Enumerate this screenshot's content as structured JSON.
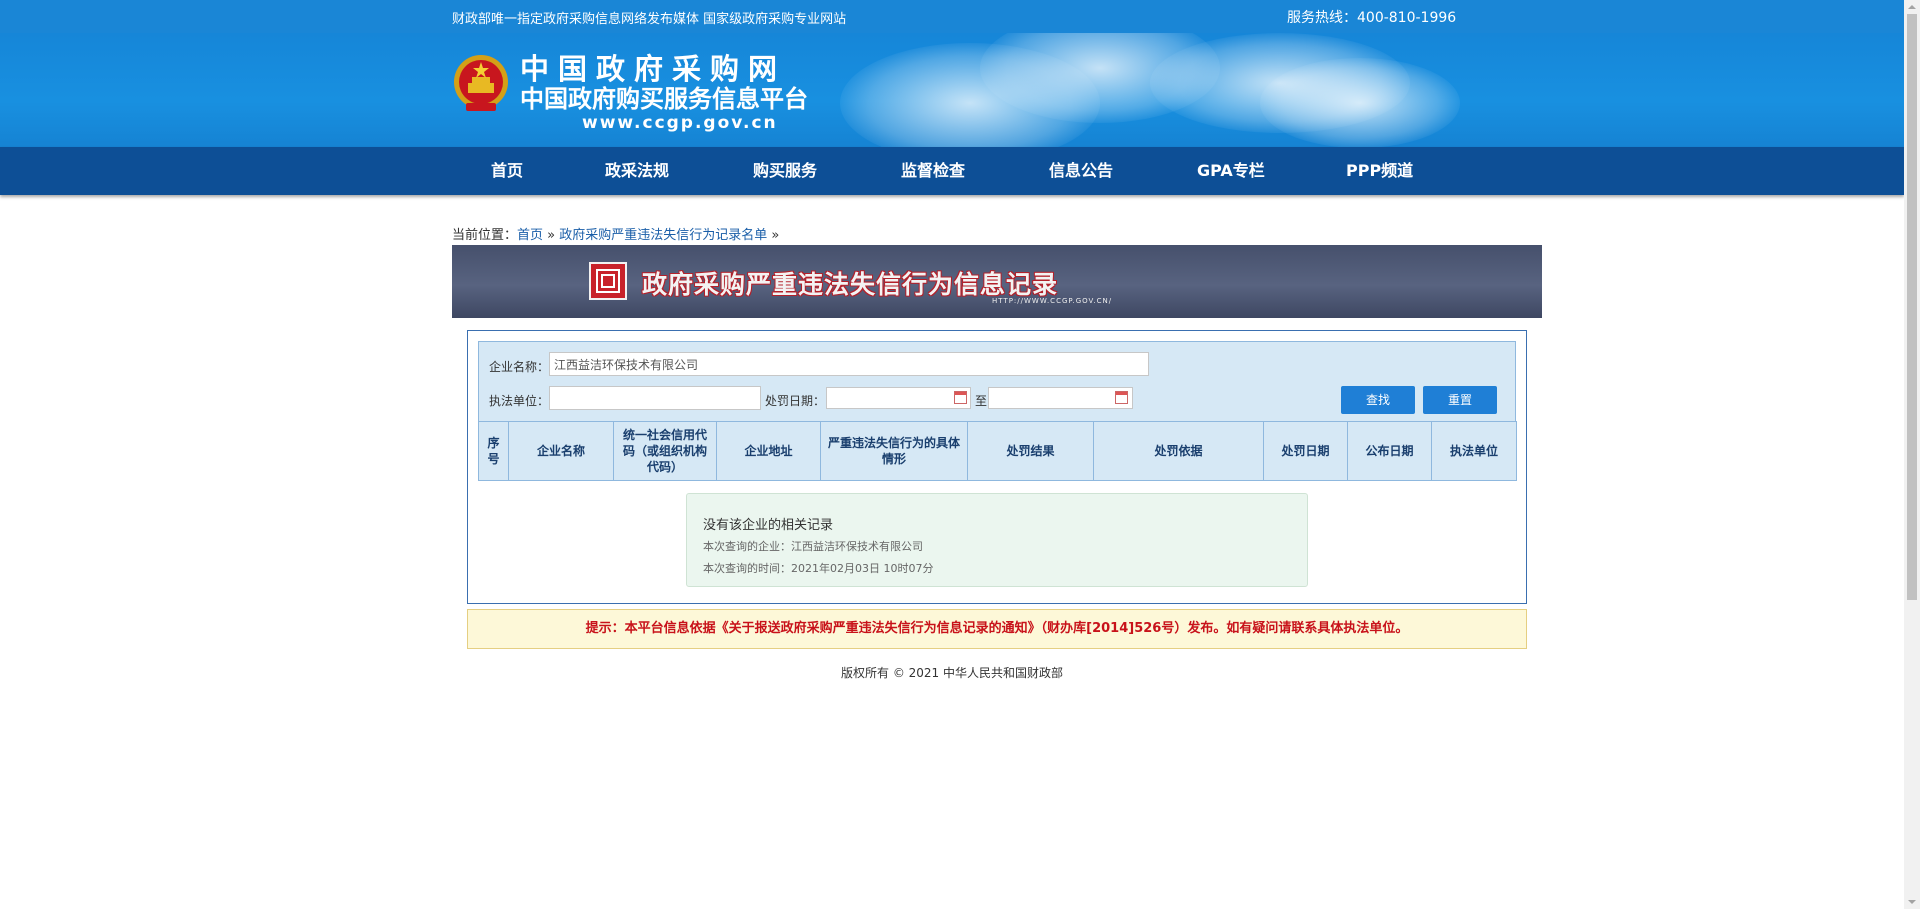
{
  "header": {
    "tagline": "财政部唯一指定政府采购信息网络发布媒体 国家级政府采购专业网站",
    "hotline": "服务热线：400-810-1996",
    "site_name_1": "中国政府采购网",
    "site_name_2": "中国政府购买服务信息平台",
    "site_url": "www.ccgp.gov.cn"
  },
  "nav": {
    "items": [
      {
        "label": "首页"
      },
      {
        "label": "政采法规"
      },
      {
        "label": "购买服务"
      },
      {
        "label": "监督检查"
      },
      {
        "label": "信息公告"
      },
      {
        "label": "GPA专栏"
      },
      {
        "label": "PPP频道"
      }
    ]
  },
  "breadcrumb": {
    "prefix": "当前位置：",
    "home": "首页",
    "sep1": " » ",
    "current": "政府采购严重违法失信行为记录名单",
    "sep2": " »"
  },
  "title_banner": {
    "title": "政府采购严重违法失信行为信息记录",
    "url": "HTTP://WWW.CCGP.GOV.CN/"
  },
  "search": {
    "company_label": "企业名称：",
    "company_value": "江西益洁环保技术有限公司",
    "unit_label": "执法单位：",
    "unit_value": "",
    "date_label": "处罚日期：",
    "date_from": "",
    "to_label": "至",
    "date_to": "",
    "search_button": "查找",
    "reset_button": "重置"
  },
  "table": {
    "headers": [
      "序号",
      "企业名称",
      "统一社会信用代码（或组织机构代码）",
      "企业地址",
      "严重违法失信行为的具体情形",
      "处罚结果",
      "处罚依据",
      "处罚日期",
      "公布日期",
      "执法单位"
    ]
  },
  "no_result": {
    "heading": "没有该企业的相关记录",
    "company_line": "本次查询的企业：江西益洁环保技术有限公司",
    "time_line": "本次查询的时间：2021年02月03日 10时07分"
  },
  "tip": "提示：本平台信息依据《关于报送政府采购严重违法失信行为信息记录的通知》（财办库[2014]526号）发布。如有疑问请联系具体执法单位。",
  "footer": {
    "copyright": "版权所有 © 2021 中华人民共和国财政部"
  },
  "colors": {
    "top_strip": "#1a86d6",
    "nav": "#0d4f96",
    "title_banner": "#4f5a76",
    "tip_text": "#c8121a",
    "button": "#1f7fd6"
  }
}
